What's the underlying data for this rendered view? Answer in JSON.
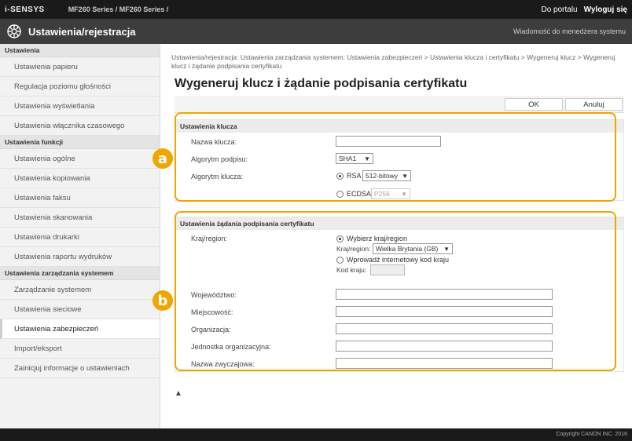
{
  "topbar": {
    "brand": "i-SENSYS",
    "model": "MF260 Series / MF260 Series /",
    "portal_link": "Do portalu",
    "logout_link": "Wyloguj się"
  },
  "titlebar": {
    "title": "Ustawienia/rejestracja",
    "message_link": "Wiadomość do menedżera systemu",
    "icon": "gear-icon"
  },
  "sidebar": {
    "groups": [
      {
        "heading": "Ustawienia",
        "items": [
          "Ustawienia papieru",
          "Regulacja poziomu głośności",
          "Ustawienia wyświetlania",
          "Ustawienia włącznika czasowego"
        ]
      },
      {
        "heading": "Ustawienia funkcji",
        "items": [
          "Ustawienia ogólne",
          "Ustawienia kopiowania",
          "Ustawienia faksu",
          "Ustawienia skanowania",
          "Ustawienia drukarki",
          "Ustawienia raportu wydruków"
        ]
      },
      {
        "heading": "Ustawienia zarządzania systemem",
        "items": [
          "Zarządzanie systemem",
          "Ustawienia sieciowe",
          "Ustawienia zabezpieczeń",
          "Import/eksport",
          "Zainicjuj informacje o ustawieniach"
        ]
      }
    ],
    "active_item": "Ustawienia zabezpieczeń"
  },
  "main": {
    "breadcrumb": "Ustawienia/rejestracja: Ustawienia zarządzania systemem: Ustawienia zabezpieczeń > Ustawienia klucza i certyfikatu > Wygeneruj klucz > Wygeneruj klucz i żądanie podpisania certyfikatu",
    "title": "Wygeneruj klucz i żądanie podpisania certyfikatu",
    "ok_label": "OK",
    "cancel_label": "Anuluj",
    "top_link": "▲"
  },
  "key_settings": {
    "heading": "Ustawienia klucza",
    "key_name_label": "Nazwa klucza:",
    "key_name_value": "",
    "signature_algorithm_label": "Algorytm podpisu:",
    "signature_algorithm_value": "SHA1",
    "key_algorithm_label": "Algorytm klucza:",
    "rsa_label": "RSA",
    "rsa_selected": true,
    "rsa_bits_value": "512-bitowy",
    "ecdsa_label": "ECDSA",
    "ecdsa_selected": false,
    "ecdsa_curve_value": "P256"
  },
  "csr_settings": {
    "heading": "Ustawienia żądania podpisania certyfikatu",
    "country_label": "Kraj/region:",
    "choose_country_label": "Wybierz kraj/region",
    "country_select_label": "Kraj/region:",
    "country_value": "Wielka Brytania (GB)",
    "enter_code_label": "Wprowadź internetowy kod kraju",
    "country_code_label": "Kod kraju:",
    "country_code_value": "",
    "province_label": "Województwo:",
    "city_label": "Miejscowość:",
    "organization_label": "Organizacja:",
    "org_unit_label": "Jednostka organizacyjna:",
    "common_name_label": "Nazwa zwyczajowa:"
  },
  "callouts": {
    "a": "a",
    "b": "b"
  },
  "accent_color": "#f0a500",
  "footer": {
    "copyright": "Copyright CANON INC. 2016"
  }
}
